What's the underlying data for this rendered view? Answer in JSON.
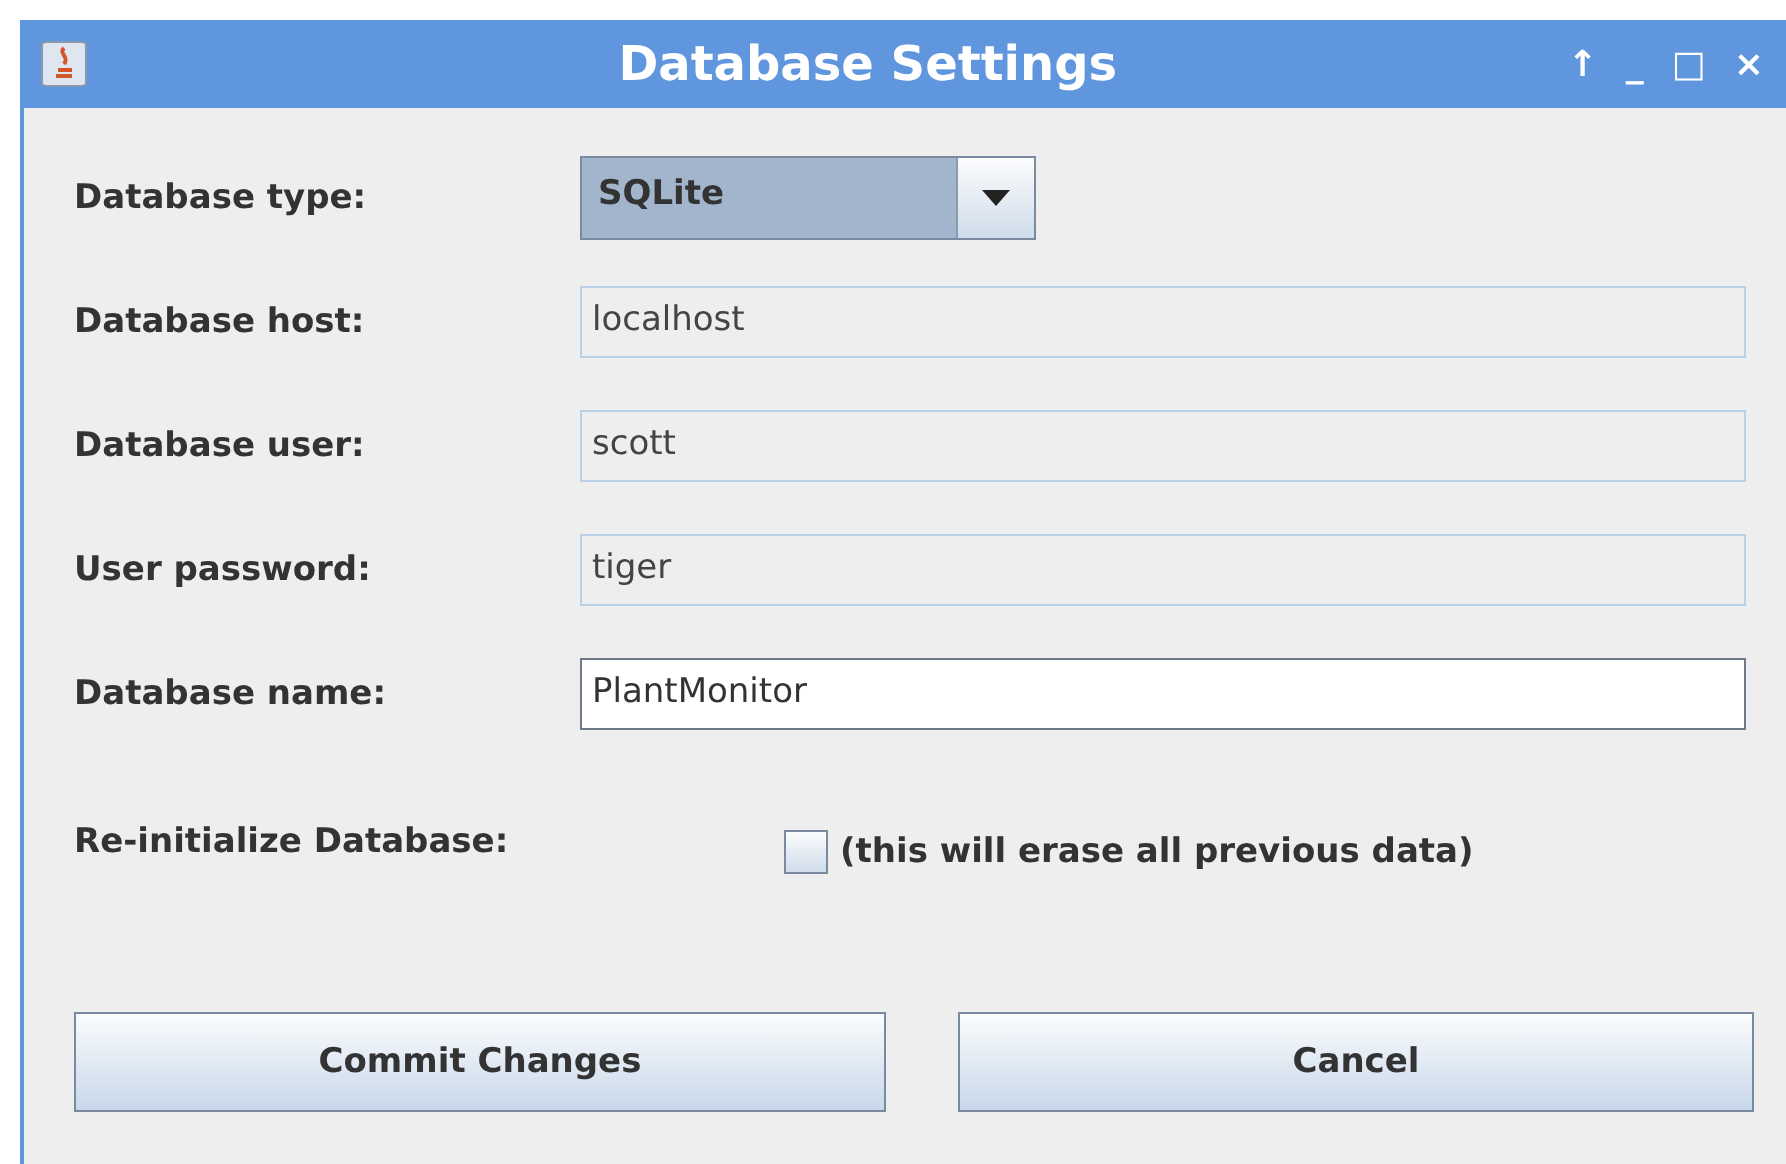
{
  "window": {
    "title": "Database Settings",
    "controls": [
      "↑",
      "_",
      "□",
      "×"
    ]
  },
  "type_field": {
    "label": "Database type:",
    "value": "SQLite"
  },
  "fields": [
    {
      "label": "Database host:",
      "value": "localhost",
      "disabled": true
    },
    {
      "label": "Database user:",
      "value": "scott",
      "disabled": true
    },
    {
      "label": "User password:",
      "value": "tiger",
      "disabled": true
    },
    {
      "label": "Database name:",
      "value": "PlantMonitor",
      "disabled": false
    }
  ],
  "reinit": {
    "label": "Re-initialize Database:",
    "checkbox_label": "(this will erase all previous data)",
    "checked": false
  },
  "buttons": [
    "Commit Changes",
    "Cancel"
  ]
}
